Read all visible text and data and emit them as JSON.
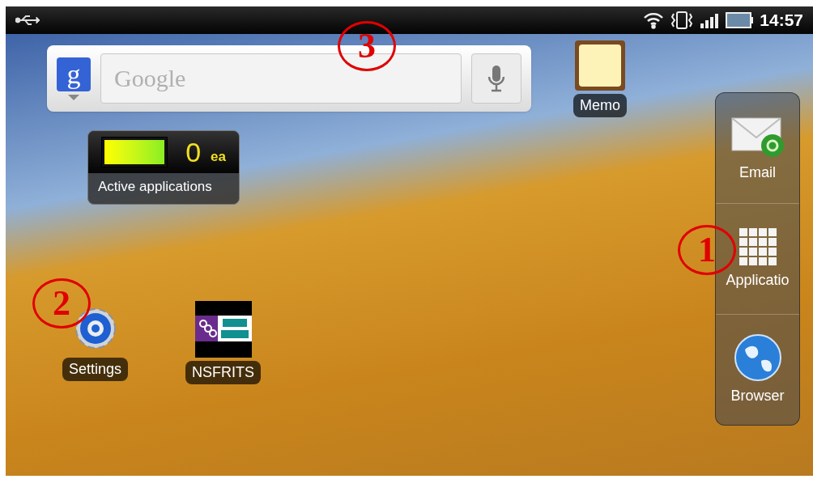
{
  "status_bar": {
    "time": "14:57"
  },
  "search_widget": {
    "logo": "g",
    "placeholder": "Google"
  },
  "memory_widget": {
    "count": "0",
    "unit": "ea",
    "label": "Active applications",
    "level": 1
  },
  "shortcuts": [
    {
      "kind": "memo",
      "label": "Memo"
    },
    {
      "kind": "settings",
      "label": "Settings"
    },
    {
      "kind": "nsfrits",
      "label": "NSFRITS"
    }
  ],
  "dock": [
    {
      "kind": "email",
      "label": "Email"
    },
    {
      "kind": "apps",
      "label": "Applicatio"
    },
    {
      "kind": "browser",
      "label": "Browser"
    }
  ],
  "annotations": [
    {
      "number": "3"
    },
    {
      "number": "2"
    },
    {
      "number": "1"
    }
  ]
}
